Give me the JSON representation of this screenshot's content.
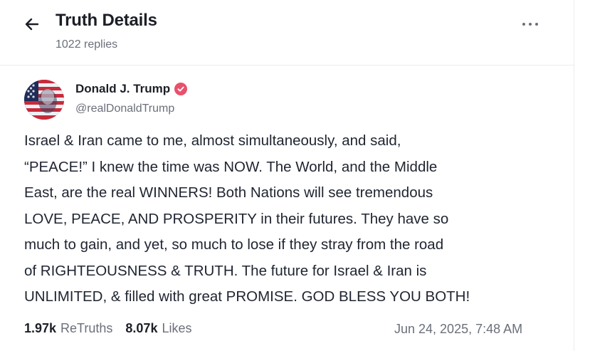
{
  "header": {
    "title": "Truth Details",
    "replies": "1022 replies"
  },
  "icons": {
    "back": "arrow-left-icon",
    "more": "more-horizontal-icon",
    "verified": "verified-badge-icon"
  },
  "post": {
    "author": {
      "name": "Donald J. Trump",
      "handle": "@realDonaldTrump",
      "verified": true,
      "verified_color": "#e8516c"
    },
    "lines": [
      "Israel & Iran came to me, almost simultaneously, and said,",
      "“PEACE!” I knew the time was NOW. The World, and the Middle",
      "East, are the real WINNERS! Both Nations will see tremendous",
      "LOVE, PEACE, AND PROSPERITY in their futures. They have so",
      "much to gain, and yet, so much to lose if they stray from the road",
      "of RIGHTEOUSNESS & TRUTH. The future for Israel & Iran is",
      "UNLIMITED, & filled with great PROMISE. GOD BLESS YOU BOTH!"
    ],
    "stats": {
      "retruths_count": "1.97k",
      "retruths_label": "ReTruths",
      "likes_count": "8.07k",
      "likes_label": "Likes"
    },
    "timestamp": "Jun 24, 2025, 7:48 AM"
  }
}
